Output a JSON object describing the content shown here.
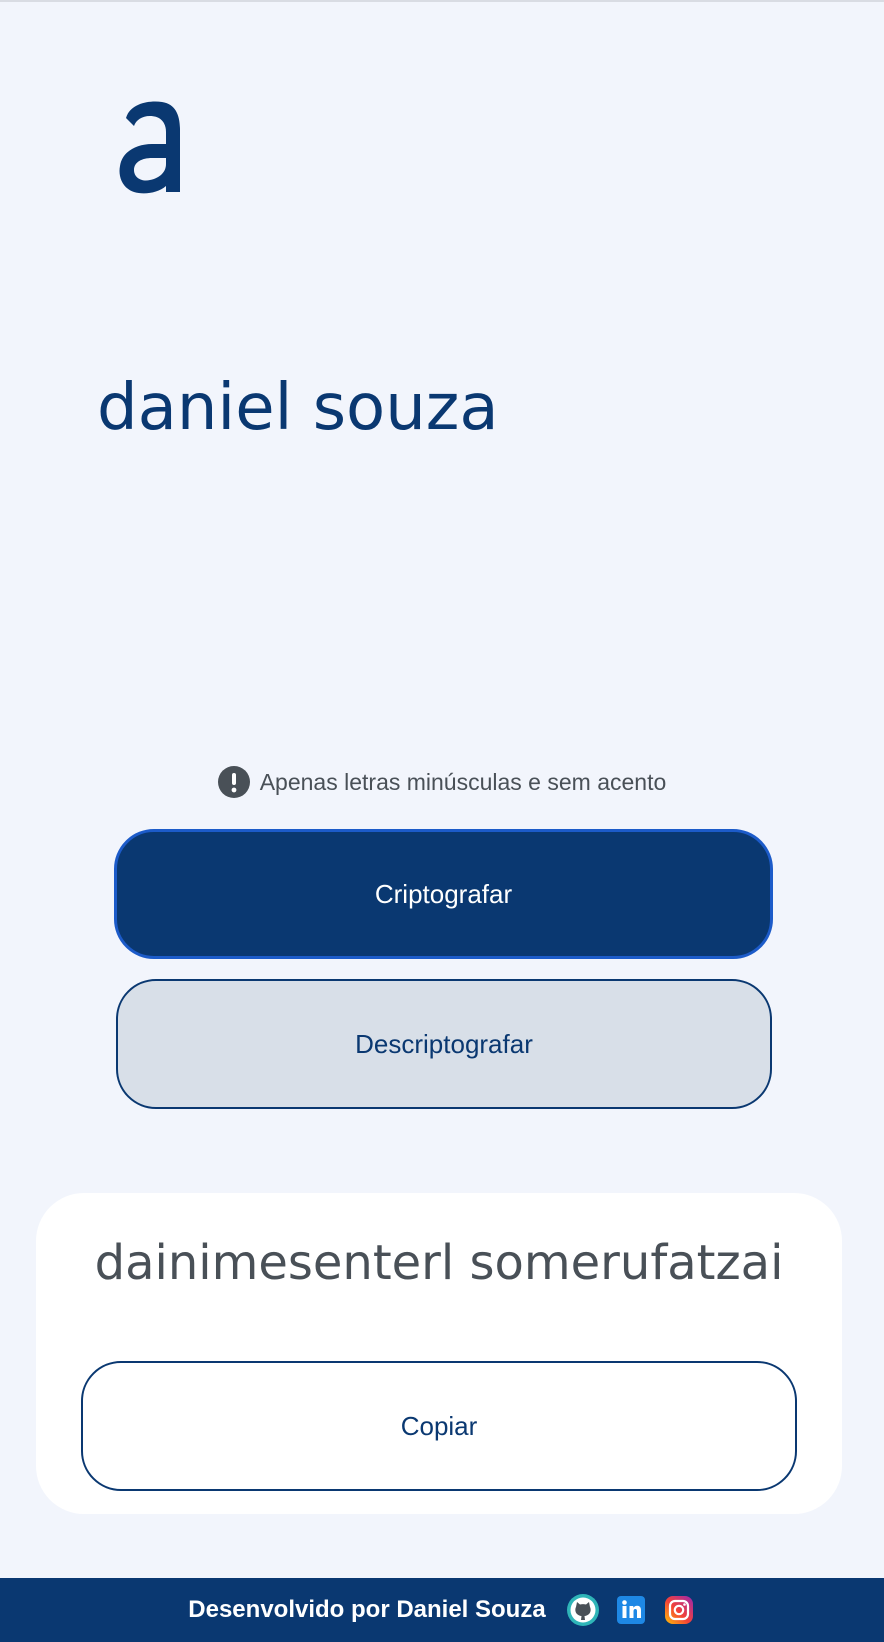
{
  "logo": {
    "letter": "a",
    "icon": "alura-a-logo"
  },
  "input": {
    "text": "daniel souza"
  },
  "hint": {
    "icon": "exclamation-circle-icon",
    "text": "Apenas letras minúsculas e sem acento"
  },
  "buttons": {
    "encrypt_label": "Criptografar",
    "decrypt_label": "Descriptografar"
  },
  "output": {
    "text": "dainimesenterl somerufatzai",
    "copy_label": "Copiar"
  },
  "footer": {
    "text": "Desenvolvido por Daniel Souza",
    "icons": [
      "github-icon",
      "linkedin-icon",
      "instagram-icon"
    ]
  },
  "colors": {
    "background": "#F2F5FC",
    "primary": "#0A3871",
    "primary_border": "#1C5BC9",
    "secondary_bg": "#D8DFE8",
    "muted_text": "#495057",
    "card_bg": "#FFFFFF"
  }
}
